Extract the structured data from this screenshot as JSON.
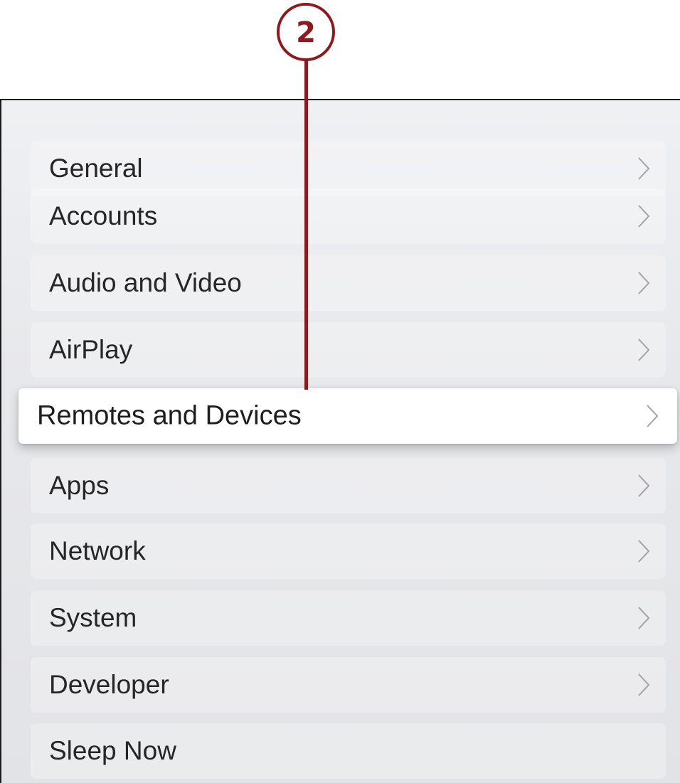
{
  "callout": {
    "number": "2",
    "color": "#8c1a1f"
  },
  "settings_menu": {
    "items": [
      {
        "label": "General",
        "chevron_icon": "chevron-right-icon",
        "focused": false
      },
      {
        "label": "Accounts",
        "chevron_icon": "chevron-right-icon",
        "focused": false
      },
      {
        "label": "Audio and Video",
        "chevron_icon": "chevron-right-icon",
        "focused": false
      },
      {
        "label": "AirPlay",
        "chevron_icon": "chevron-right-icon",
        "focused": false
      },
      {
        "label": "Remotes and Devices",
        "chevron_icon": "chevron-right-icon",
        "focused": true
      },
      {
        "label": "Apps",
        "chevron_icon": "chevron-right-icon",
        "focused": false
      },
      {
        "label": "Network",
        "chevron_icon": "chevron-right-icon",
        "focused": false
      },
      {
        "label": "System",
        "chevron_icon": "chevron-right-icon",
        "focused": false
      },
      {
        "label": "Developer",
        "chevron_icon": "chevron-right-icon",
        "focused": false
      },
      {
        "label": "Sleep Now",
        "chevron_icon": null,
        "focused": false
      }
    ]
  }
}
